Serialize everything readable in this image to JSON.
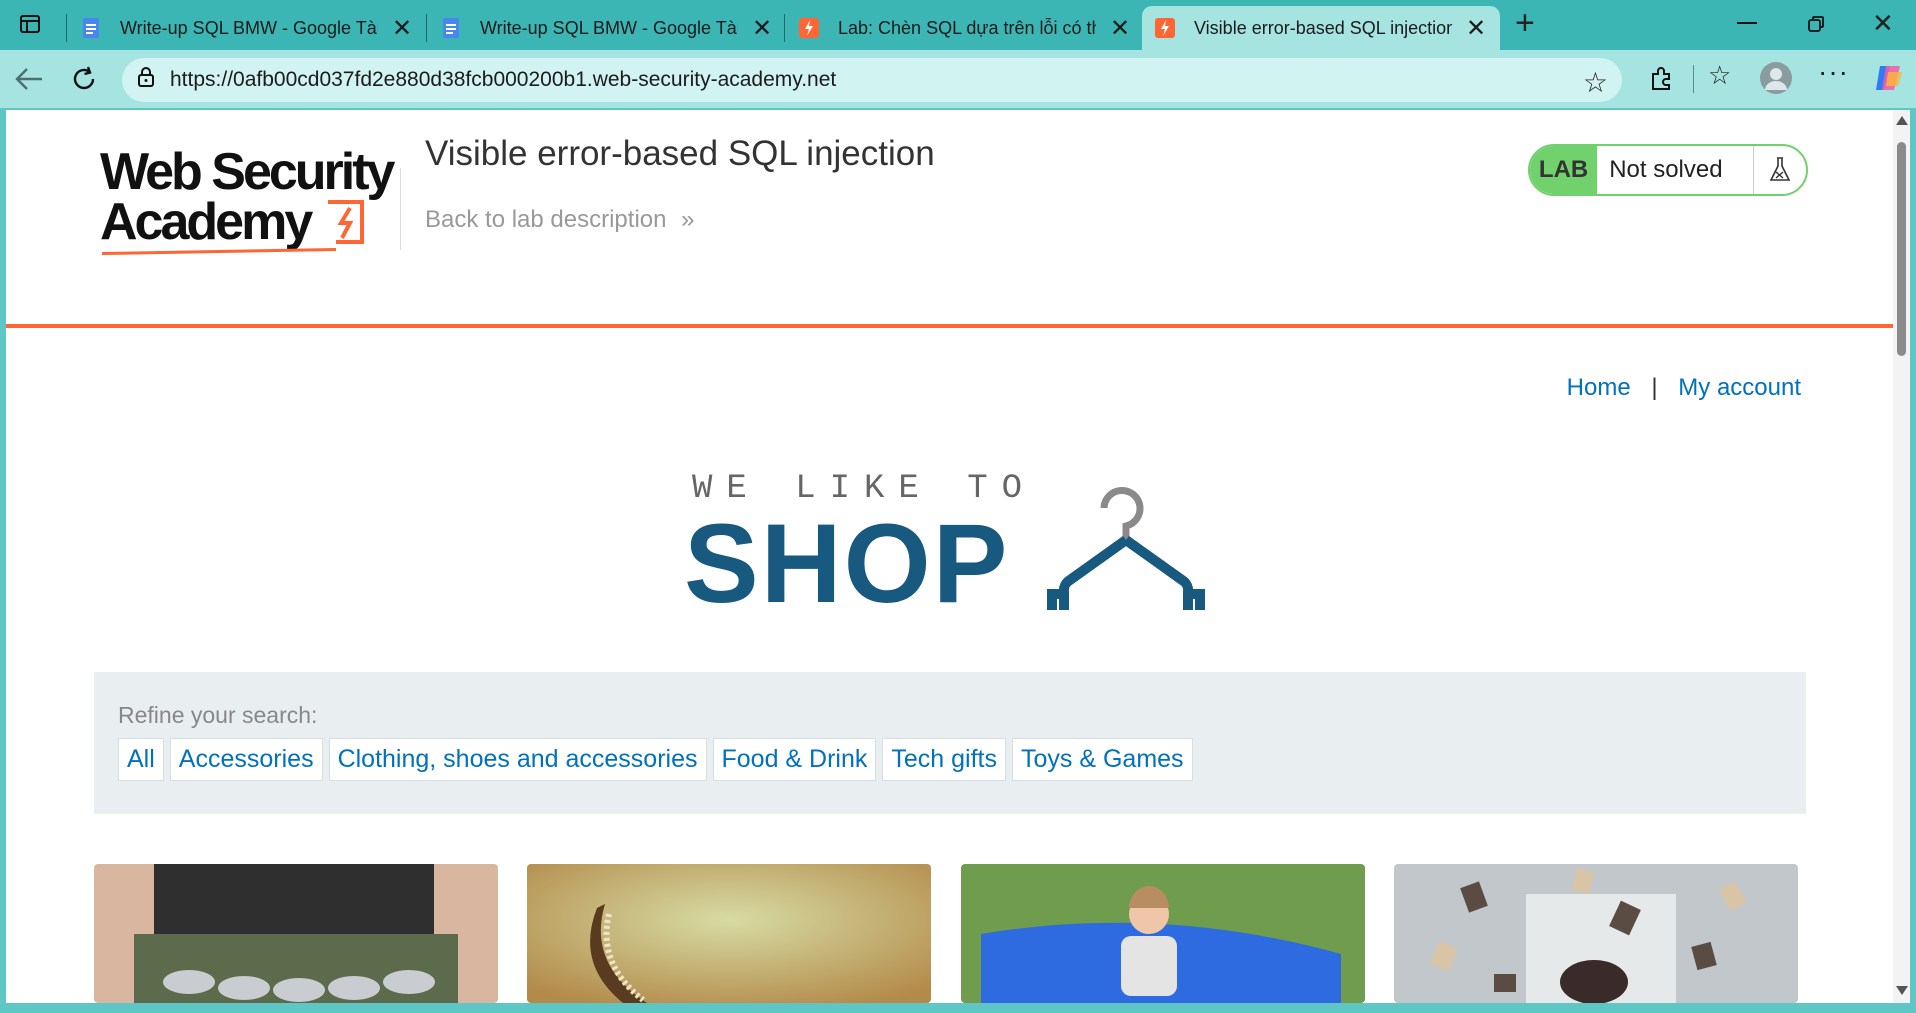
{
  "browser": {
    "tabs": [
      {
        "title": "Write-up SQL BMW - Google Tài liệu",
        "favicon": "google-docs-icon",
        "active": false
      },
      {
        "title": "Write-up SQL BMW - Google Tài liệu",
        "favicon": "google-docs-icon",
        "active": false
      },
      {
        "title": "Lab: Chèn SQL dựa trên lỗi có thể nhìn thấy",
        "favicon": "portswigger-icon",
        "active": false
      },
      {
        "title": "Visible error-based SQL injection",
        "favicon": "portswigger-icon",
        "active": true
      }
    ],
    "new_tab_label": "+",
    "url": "https://0afb00cd037fd2e880d38fcb000200b1.web-security-academy.net"
  },
  "header": {
    "logo_line1": "Web Security",
    "logo_line2": "Academy",
    "lab_title": "Visible error-based SQL injection",
    "back_link": "Back to lab description",
    "lab_badge": "LAB",
    "lab_status": "Not solved"
  },
  "nav": {
    "home": "Home",
    "separator": "|",
    "account": "My account"
  },
  "banner": {
    "line1": "WE LIKE TO",
    "line2": "SHOP"
  },
  "filters": {
    "label": "Refine your search:",
    "categories": [
      "All",
      "Accessories",
      "Clothing, shoes and accessories",
      "Food & Drink",
      "Tech gifts",
      "Toys & Games"
    ]
  },
  "products": [
    {
      "image": "beer-belt-image"
    },
    {
      "image": "mustache-comb-image"
    },
    {
      "image": "girl-on-beanbag-image"
    },
    {
      "image": "flying-books-image"
    }
  ],
  "colors": {
    "accent_orange": "#ff6633",
    "lab_green": "#70d16d",
    "link_blue": "#0071bc",
    "shop_blue": "#17597f",
    "browser_teal": "#3cb6b4"
  }
}
